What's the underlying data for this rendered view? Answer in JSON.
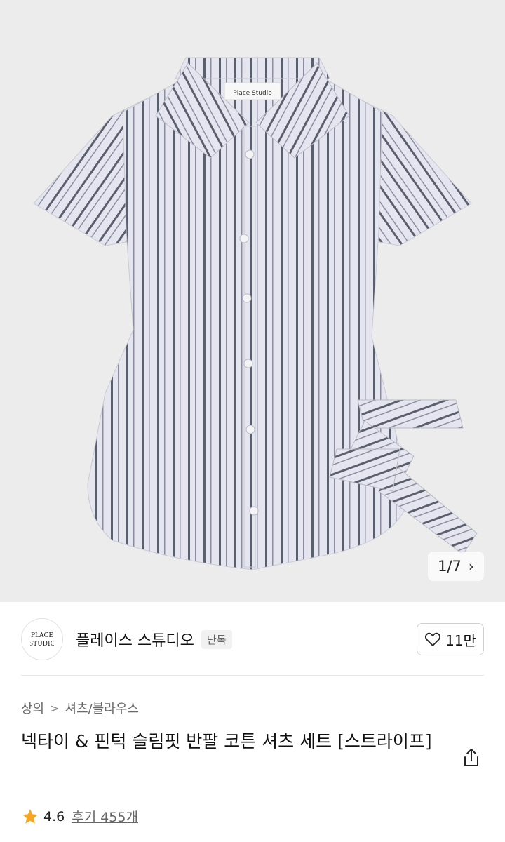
{
  "product_image": {
    "label_text": "Place Studio",
    "pager_text": "1/7",
    "colors": {
      "background": "#ececec",
      "shirt": "#e6e6ee",
      "stripe": "#5a5f6e"
    }
  },
  "brand": {
    "name": "플레이스 스튜디오",
    "badge": "단독",
    "logo_text": "PLACE STUDIO"
  },
  "like": {
    "count": "11만",
    "icon": "heart-outline-icon"
  },
  "breadcrumb": {
    "items": [
      "상의",
      "셔츠/블라우스"
    ],
    "separator": ">"
  },
  "product": {
    "title": "넥타이 & 핀턱 슬림핏 반팔 코튼 셔츠 세트 [스트라이프]"
  },
  "rating": {
    "score": "4.6",
    "reviews": "후기 455개",
    "star_color": "#f5a623"
  },
  "share": {
    "icon": "share-icon"
  }
}
